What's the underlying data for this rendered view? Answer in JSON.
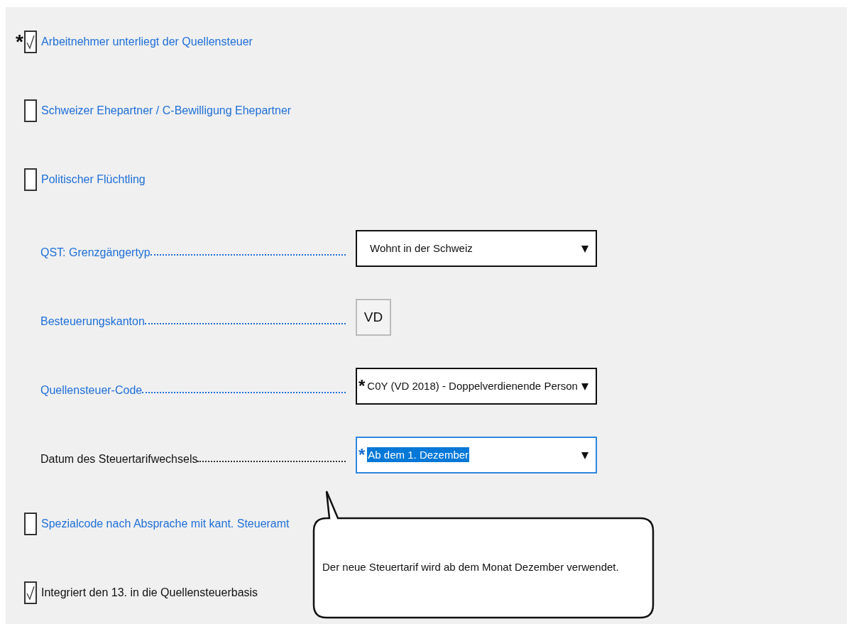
{
  "items": [
    {
      "kind": "checkbox",
      "marker": "*",
      "checked": true,
      "linked": true,
      "label": "Arbeitnehmer unterliegt der Quellensteuer"
    },
    {
      "kind": "checkbox",
      "checked": false,
      "linked": true,
      "label": "Schweizer Ehepartner / C-Bewilligung Ehepartner"
    },
    {
      "kind": "checkbox",
      "checked": false,
      "linked": true,
      "label": "Politischer Flüchtling"
    },
    {
      "kind": "select",
      "linked": true,
      "label": "QST: Grenzgängertyp",
      "value": "Wohnt in der Schweiz",
      "focused": false
    },
    {
      "kind": "readonly",
      "linked": true,
      "label": "Besteuerungskanton",
      "value": "VD"
    },
    {
      "kind": "select",
      "linked": true,
      "label": "Quellensteuer-Code",
      "marker": "*",
      "value": "C0Y (VD 2018) - Doppelverdienende Person",
      "focused": false
    },
    {
      "kind": "select",
      "linked": false,
      "label": "Datum des Steuertarifwechsels",
      "marker": "*",
      "value": "Ab dem 1. Dezember",
      "focused": true
    },
    {
      "kind": "checkbox",
      "checked": false,
      "linked": true,
      "label": "Spezialcode nach Absprache mit kant. Steueramt"
    },
    {
      "kind": "checkbox",
      "checked": true,
      "linked": false,
      "label": "Integriert den 13. in die Quellensteuerbasis"
    }
  ],
  "tooltip": {
    "text": "Der neue Steuertarif wird ab dem Monat Dezember verwendet."
  }
}
